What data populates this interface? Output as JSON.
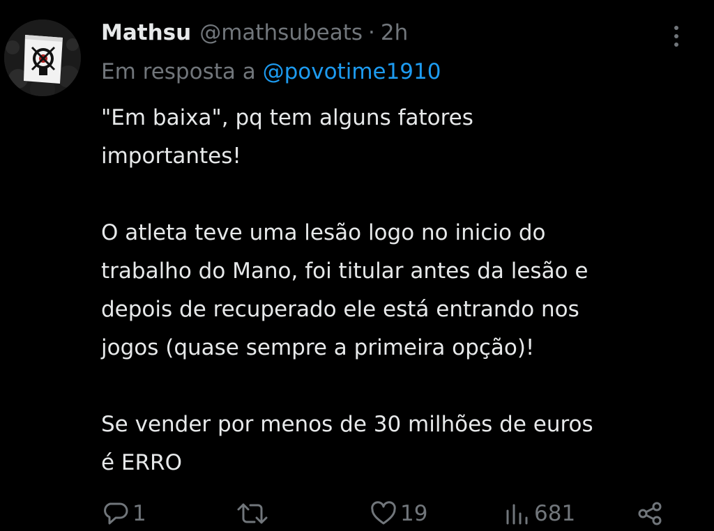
{
  "tweet": {
    "display_name": "Mathsu",
    "handle": "@mathsubeats",
    "separator": "·",
    "time": "2h",
    "reply_prefix": "Em resposta a",
    "reply_mention": "@povotime1910",
    "lines": [
      "\"Em baixa\", pq tem alguns fatores",
      "importantes!",
      "",
      "O atleta teve uma lesão logo no inicio do",
      "trabalho do Mano,  foi titular antes da lesão e",
      "depois de recuperado ele está entrando nos",
      "jogos (quase sempre a primeira opção)!",
      "",
      "Se vender por menos de 30 milhões de euros",
      "é ERRO"
    ]
  },
  "actions": {
    "replies": "1",
    "likes": "19",
    "views": "681"
  },
  "icons": {
    "more": "more-vertical-icon",
    "reply": "reply-icon",
    "retweet": "retweet-icon",
    "like": "heart-icon",
    "views": "views-icon",
    "share": "share-icon"
  },
  "colors": {
    "background": "#000000",
    "text": "#e7e9ea",
    "secondary": "#71767b",
    "link": "#1d9bf0"
  }
}
